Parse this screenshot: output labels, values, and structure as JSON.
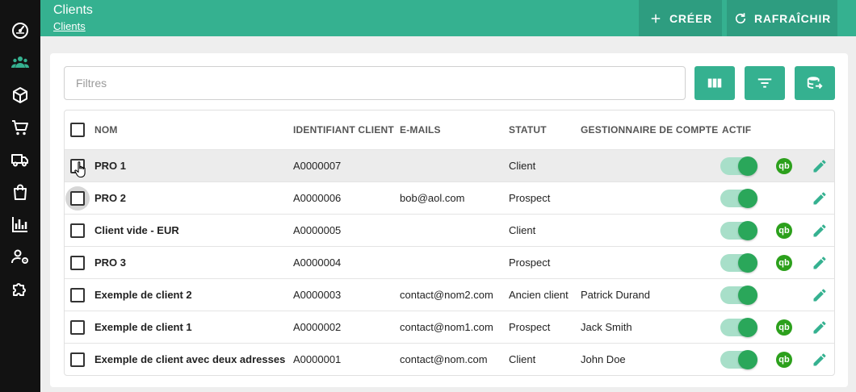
{
  "sidebar": {
    "items": [
      {
        "name": "dashboard",
        "icon": "speedometer-icon"
      },
      {
        "name": "clients",
        "icon": "people-icon",
        "active": true
      },
      {
        "name": "products",
        "icon": "cube-icon"
      },
      {
        "name": "orders",
        "icon": "cart-icon"
      },
      {
        "name": "deliveries",
        "icon": "truck-icon"
      },
      {
        "name": "purchases",
        "icon": "shopping-bag-icon"
      },
      {
        "name": "reports",
        "icon": "bar-chart-icon"
      },
      {
        "name": "user-settings",
        "icon": "user-gear-icon"
      },
      {
        "name": "extensions",
        "icon": "puzzle-icon"
      }
    ]
  },
  "header": {
    "title": "Clients",
    "breadcrumb": "Clients",
    "create_label": "CRÉER",
    "refresh_label": "RAFRAÎCHIR"
  },
  "filters": {
    "placeholder": "Filtres",
    "value": ""
  },
  "toolbar": {
    "columns_icon": "view-columns-icon",
    "filter_icon": "filter-list-icon",
    "export_icon": "database-export-icon"
  },
  "table": {
    "columns": {
      "name": "NOM",
      "id": "IDENTIFIANT CLIENT",
      "email": "E-MAILS",
      "status": "STATUT",
      "manager": "GESTIONNAIRE DE COMPTE",
      "active": "ACTIF"
    },
    "rows": [
      {
        "name": "PRO 1",
        "id": "A0000007",
        "email": "",
        "status": "Client",
        "manager": "",
        "active": true,
        "quickbooks": true
      },
      {
        "name": "PRO 2",
        "id": "A0000006",
        "email": "bob@aol.com",
        "status": "Prospect",
        "manager": "",
        "active": true,
        "quickbooks": false
      },
      {
        "name": "Client vide - EUR",
        "id": "A0000005",
        "email": "",
        "status": "Client",
        "manager": "",
        "active": true,
        "quickbooks": true
      },
      {
        "name": "PRO 3",
        "id": "A0000004",
        "email": "",
        "status": "Prospect",
        "manager": "",
        "active": true,
        "quickbooks": true
      },
      {
        "name": "Exemple de client 2",
        "id": "A0000003",
        "email": "contact@nom2.com",
        "status": "Ancien client",
        "manager": "Patrick Durand",
        "active": true,
        "quickbooks": false
      },
      {
        "name": "Exemple de client 1",
        "id": "A0000002",
        "email": "contact@nom1.com",
        "status": "Prospect",
        "manager": "Jack Smith",
        "active": true,
        "quickbooks": true
      },
      {
        "name": "Exemple de client avec deux adresses",
        "id": "A0000001",
        "email": "contact@nom.com",
        "status": "Client",
        "manager": "John Doe",
        "active": true,
        "quickbooks": true
      }
    ],
    "quickbooks_label": "qb"
  },
  "colors": {
    "accent": "#35b190",
    "accent_dark": "#2e9d80",
    "sidebar_bg": "#121212",
    "toggle_on": "#2aa75a",
    "quickbooks_green": "#2ca01c"
  }
}
